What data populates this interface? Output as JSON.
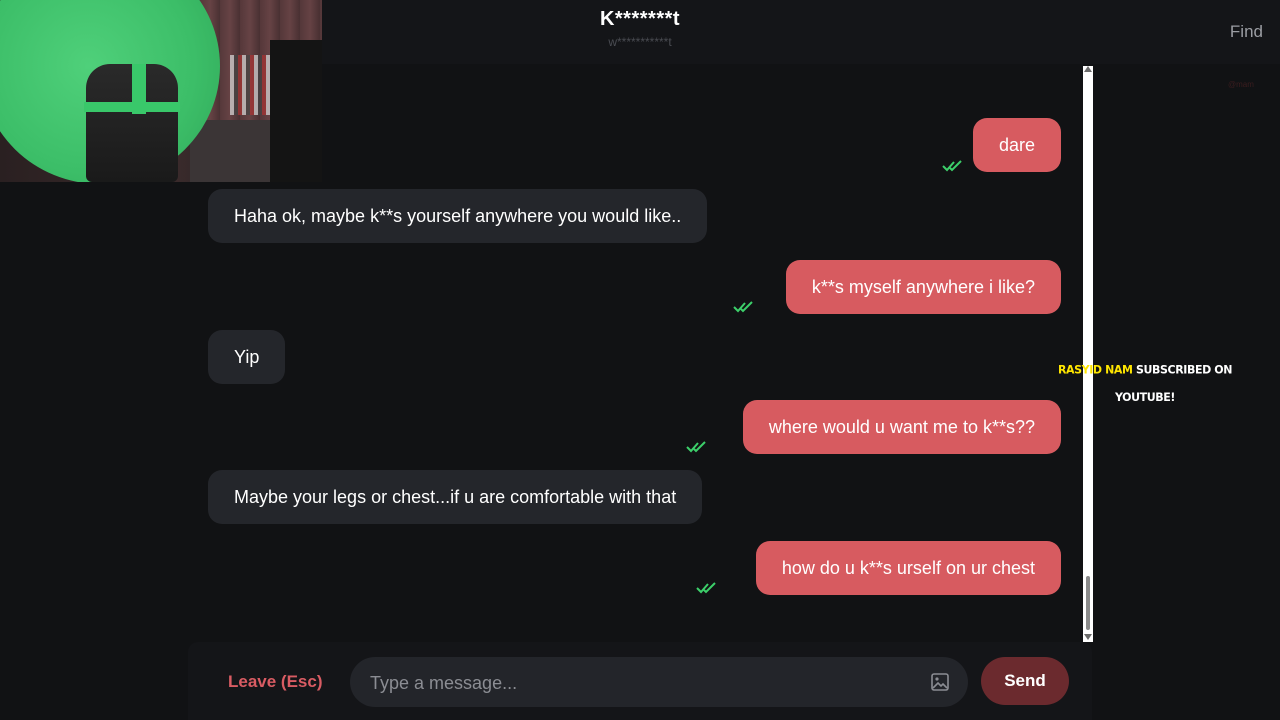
{
  "header": {
    "partner_name": "K*******t",
    "partner_username": "w***********t",
    "find_label": "Find"
  },
  "messages": [
    {
      "direction": "sent",
      "text": "dare",
      "status": "read"
    },
    {
      "direction": "received",
      "text": "Haha ok, maybe k**s yourself anywhere you would like.."
    },
    {
      "direction": "sent",
      "text": "k**s myself anywhere i like?",
      "status": "read"
    },
    {
      "direction": "received",
      "text": "Yip"
    },
    {
      "direction": "sent",
      "text": "where would u want me to k**s??",
      "status": "read"
    },
    {
      "direction": "received",
      "text": "Maybe your legs or chest...if u are comfortable with that"
    },
    {
      "direction": "sent",
      "text": "how do u k**s urself on ur chest",
      "status": "read"
    }
  ],
  "overlay": {
    "subscriber_name": "RASYID NAM",
    "subscriber_text": "SUBSCRIBED ON YOUTUBE!",
    "faint_text": "@mam"
  },
  "footer": {
    "leave_label": "Leave (Esc)",
    "input_placeholder": "Type a message...",
    "input_value": "",
    "send_label": "Send"
  },
  "colors": {
    "background": "#111214",
    "sent_bubble": "#d75b60",
    "received_bubble": "#24262b",
    "read_tick": "#3ccf6a",
    "leave": "#d95c63",
    "send_button": "#6b2a2e"
  },
  "icons": {
    "read_receipt": "double-check-icon",
    "attach_image": "image-icon"
  }
}
